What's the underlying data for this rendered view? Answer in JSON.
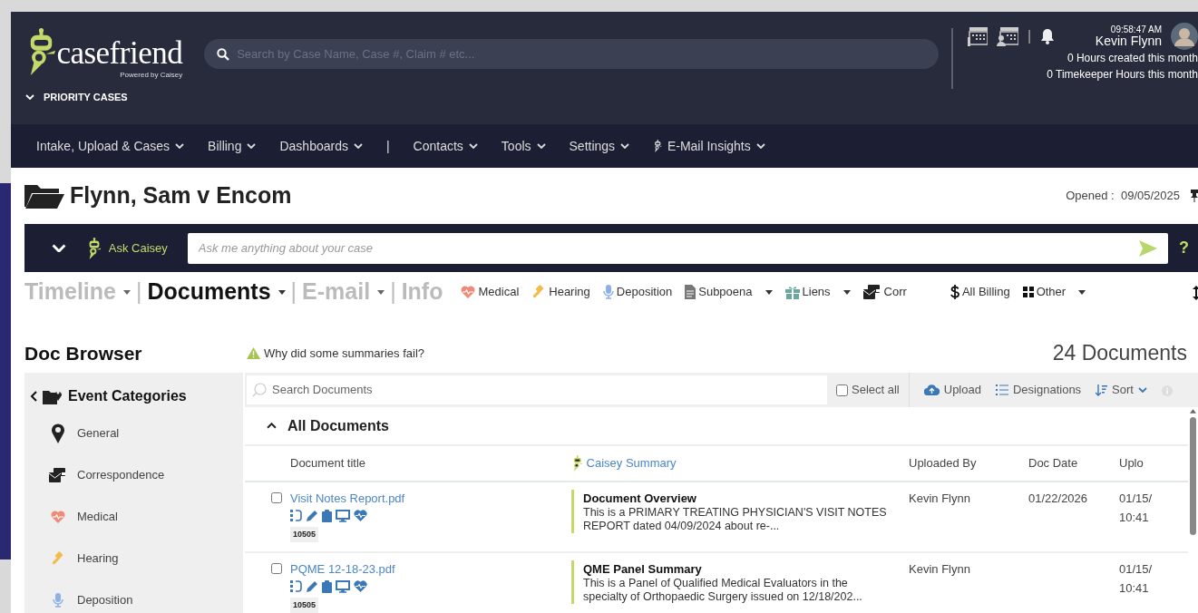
{
  "header": {
    "logo": {
      "name": "casefriend",
      "tagline": "Powered by Caisey"
    },
    "search": {
      "placeholder": "Search by Case Name, Case #, Claim # etc..."
    },
    "priority_toggle": "PRIORITY CASES",
    "divider": "|",
    "time": "09:58:47 AM",
    "user": "Kevin Flynn",
    "hours_created": "0 Hours created this month",
    "timekeeper_hours": "0 Timekeeper Hours this month"
  },
  "nav": [
    {
      "label": "Intake, Upload & Cases",
      "kind": "menu"
    },
    {
      "label": "Billing",
      "kind": "menu"
    },
    {
      "label": "Dashboards",
      "kind": "menu"
    },
    {
      "label": "|",
      "kind": "separator"
    },
    {
      "label": "Contacts",
      "kind": "menu"
    },
    {
      "label": "Tools",
      "kind": "menu"
    },
    {
      "label": "Settings",
      "kind": "menu"
    },
    {
      "label": "E-Mail Insights",
      "kind": "insights"
    }
  ],
  "case": {
    "title": "Flynn, Sam v Encom",
    "opened_label": "Opened :",
    "opened_date": "09/05/2025"
  },
  "ask": {
    "label": "Ask Caisey",
    "placeholder": "Ask me anything about your case",
    "help": "?"
  },
  "view_tabs": [
    {
      "label": "Timeline",
      "selected": false,
      "dropdown": true
    },
    {
      "label": "Documents",
      "selected": true,
      "dropdown": true
    },
    {
      "label": "E-mail",
      "selected": false,
      "dropdown": true
    },
    {
      "label": "Info",
      "selected": false,
      "dropdown": false
    }
  ],
  "view_tab_separator": "|",
  "filters": [
    {
      "label": "Medical",
      "kind": "medical",
      "dropdown": false
    },
    {
      "label": "Hearing",
      "kind": "hearing",
      "dropdown": false
    },
    {
      "label": "Deposition",
      "kind": "deposition",
      "dropdown": false
    },
    {
      "label": "Subpoena",
      "kind": "subpoena",
      "dropdown": true
    },
    {
      "label": "Liens",
      "kind": "liens",
      "dropdown": true
    },
    {
      "label": "Corr",
      "kind": "correspondence",
      "dropdown": false
    },
    {
      "label": "All Billing",
      "kind": "billing",
      "dropdown": false
    },
    {
      "label": "Other",
      "kind": "other",
      "dropdown": true
    }
  ],
  "doc_browser": {
    "title": "Doc Browser",
    "warning": "Why did some summaries fail?",
    "count": "24 Documents"
  },
  "categories": {
    "title": "Event Categories",
    "items": [
      {
        "label": "General",
        "kind": "general"
      },
      {
        "label": "Correspondence",
        "kind": "correspondence"
      },
      {
        "label": "Medical",
        "kind": "medical"
      },
      {
        "label": "Hearing",
        "kind": "hearing"
      },
      {
        "label": "Deposition",
        "kind": "deposition"
      }
    ]
  },
  "toolbar": {
    "search_placeholder": "Search Documents",
    "select_all": {
      "label": "Select all",
      "checked": false
    },
    "actions": [
      {
        "label": "Upload",
        "kind": "upload"
      },
      {
        "label": "Designations",
        "kind": "list"
      },
      {
        "label": "Sort",
        "kind": "sort"
      }
    ]
  },
  "documents": {
    "group": "All Documents",
    "expanded": true,
    "columns": [
      "Document title",
      "Caisey Summary",
      "Uploaded By",
      "Doc Date",
      "Uplo"
    ],
    "rows": [
      {
        "checked": false,
        "title": "Visit Notes Report.pdf",
        "badge": "10505",
        "summary_title": "Document Overview",
        "summary": "This is a PRIMARY TREATING PHYSICIAN'S VISIT NOTES REPORT dated 04/09/2024 about re-...",
        "uploaded_by": "Kevin Flynn",
        "doc_date": "01/22/2026",
        "upload_date": "01/15/",
        "upload_time": "10:41"
      },
      {
        "checked": false,
        "title": "PQME 12-18-23.pdf",
        "badge": "10505",
        "summary_title": "QME Panel Summary",
        "summary": "This is a Panel of Qualified Medical Evaluators in the specialty of Orthopaedic Surgery issued on 12/18/202...",
        "uploaded_by": "Kevin Flynn",
        "doc_date": "",
        "upload_date": "01/15/",
        "upload_time": "10:41"
      }
    ]
  }
}
